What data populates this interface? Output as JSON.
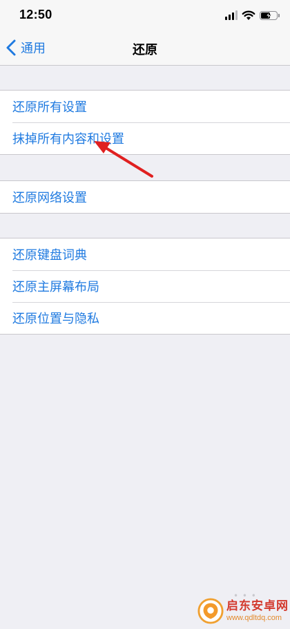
{
  "status_bar": {
    "time": "12:50"
  },
  "nav": {
    "back_label": "通用",
    "title": "还原"
  },
  "groups": [
    {
      "items": [
        {
          "label": "还原所有设置"
        },
        {
          "label": "抹掉所有内容和设置"
        }
      ]
    },
    {
      "items": [
        {
          "label": "还原网络设置"
        }
      ]
    },
    {
      "items": [
        {
          "label": "还原键盘词典"
        },
        {
          "label": "还原主屏幕布局"
        },
        {
          "label": "还原位置与隐私"
        }
      ]
    }
  ],
  "annotation": {
    "color": "#e02020"
  },
  "watermark": {
    "title": "启东安卓网",
    "url": "www.qdltdq.com"
  },
  "colors": {
    "accent": "#1f7ae0",
    "background": "#efeff4"
  }
}
